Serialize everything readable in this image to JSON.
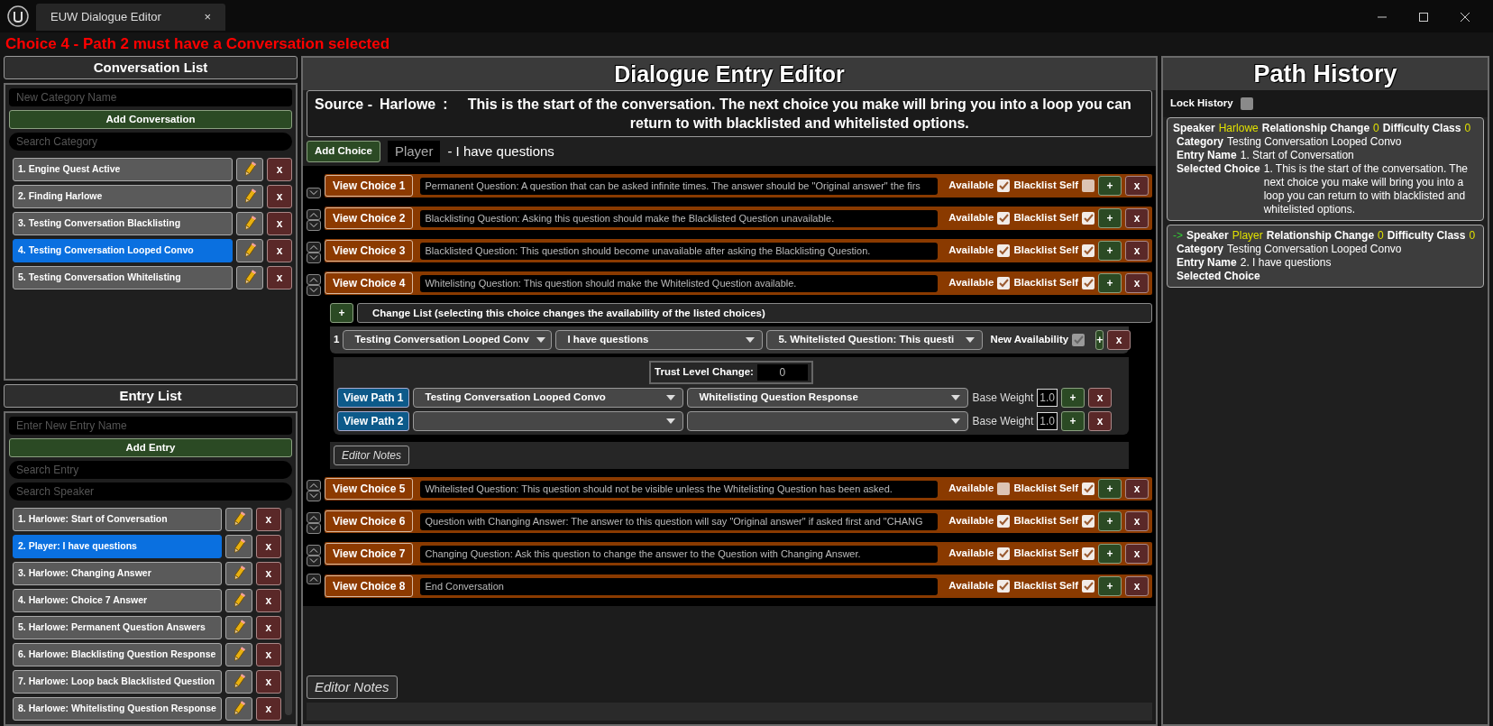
{
  "window": {
    "title": "EUW Dialogue Editor",
    "close": "×"
  },
  "error": "Choice 4 - Path 2 must have a Conversation selected",
  "conversation_list": {
    "title": "Conversation List",
    "new_placeholder": "New Category Name",
    "add_button": "Add Conversation",
    "search_placeholder": "Search Category",
    "items": [
      {
        "label": "1. Engine Quest Active",
        "selected": false,
        "remove": "x"
      },
      {
        "label": "2. Finding Harlowe",
        "selected": false,
        "remove": "x"
      },
      {
        "label": "3. Testing Conversation Blacklisting",
        "selected": false,
        "remove": "x"
      },
      {
        "label": "4. Testing Conversation Looped Convo",
        "selected": true,
        "remove": "x"
      },
      {
        "label": "5. Testing Conversation Whitelisting",
        "selected": false,
        "remove": "x"
      }
    ]
  },
  "entry_list": {
    "title": "Entry List",
    "new_placeholder": "Enter New Entry Name",
    "add_button": "Add Entry",
    "search_entry_placeholder": "Search Entry",
    "search_speaker_placeholder": "Search Speaker",
    "items": [
      {
        "label": "1. Harlowe: Start of Conversation",
        "selected": false,
        "remove": "x"
      },
      {
        "label": "2. Player: I have questions",
        "selected": true,
        "remove": "x"
      },
      {
        "label": "3. Harlowe: Changing Answer",
        "selected": false,
        "remove": "x"
      },
      {
        "label": "4. Harlowe: Choice 7 Answer",
        "selected": false,
        "remove": "x"
      },
      {
        "label": "5. Harlowe: Permanent Question Answers",
        "selected": false,
        "remove": "x"
      },
      {
        "label": "6. Harlowe: Blacklisting Question Response",
        "selected": false,
        "remove": "x"
      },
      {
        "label": "7. Harlowe: Loop back Blacklisted Question",
        "selected": false,
        "remove": "x"
      },
      {
        "label": "8. Harlowe: Whitelisting Question Response",
        "selected": false,
        "remove": "x"
      }
    ]
  },
  "editor": {
    "title": "Dialogue Entry Editor",
    "source_label": "Source -",
    "source_speaker": "Harlowe",
    "source_colon": ":",
    "source_text": "This is the start of the conversation. The next choice you make will bring you into a loop you can return to with blacklisted and whitelisted options.",
    "add_choice": "Add Choice",
    "speaker": "Player",
    "entry_text": "- I have questions",
    "choices": [
      {
        "move_up": false,
        "move_down": true,
        "button": "View Choice 1",
        "text": "Permanent Question: A question that can be asked infinite times. The answer should be \"Original answer\" the firs",
        "available_label": "Available",
        "available": true,
        "blacklist_label": "Blacklist Self",
        "blacklist_self": false,
        "add": "+",
        "remove": "x"
      },
      {
        "move_up": true,
        "move_down": true,
        "button": "View Choice 2",
        "text": "Blacklisting Question: Asking this question should make the Blacklisted Question unavailable.",
        "available_label": "Available",
        "available": true,
        "blacklist_label": "Blacklist Self",
        "blacklist_self": true,
        "add": "+",
        "remove": "x"
      },
      {
        "move_up": true,
        "move_down": true,
        "button": "View Choice 3",
        "text": "Blacklisted Question: This question should become unavailable after asking the Blacklisting Question.",
        "available_label": "Available",
        "available": true,
        "blacklist_label": "Blacklist Self",
        "blacklist_self": true,
        "add": "+",
        "remove": "x"
      },
      {
        "move_up": true,
        "move_down": true,
        "button": "View Choice 4",
        "text": "Whitelisting Question: This question should make the Whitelisted Question available.",
        "available_label": "Available",
        "available": true,
        "blacklist_label": "Blacklist Self",
        "blacklist_self": true,
        "add": "+",
        "remove": "x",
        "details": {
          "change_add": "+",
          "change_title": "Change List (selecting this choice changes the availability of the listed choices)",
          "change_rows": [
            {
              "index": "1",
              "conversation": "Testing Conversation Looped Conv",
              "entry": "I have questions",
              "choice": "5. Whitelisted Question: This questi",
              "availability_label": "New Availability",
              "new_availability": true,
              "add": "+",
              "remove": "x"
            }
          ],
          "trust_label": "Trust Level Change:",
          "trust_value": "0",
          "paths": [
            {
              "button": "View Path 1",
              "conversation": "Testing Conversation Looped Convo",
              "entry": "Whitelisting Question Response",
              "weight_label": "Base Weight",
              "weight": "1.0",
              "add": "+",
              "remove": "x"
            },
            {
              "button": "View Path 2",
              "weight_label": "Base Weight",
              "weight": "1.0",
              "add": "+",
              "remove": "x"
            }
          ],
          "editor_notes": "Editor Notes"
        }
      },
      {
        "move_up": true,
        "move_down": true,
        "button": "View Choice 5",
        "text": "Whitelisted Question: This question should not be visible unless the Whitelisting Question has been asked.",
        "available_label": "Available",
        "available": false,
        "blacklist_label": "Blacklist Self",
        "blacklist_self": true,
        "add": "+",
        "remove": "x"
      },
      {
        "move_up": true,
        "move_down": true,
        "button": "View Choice 6",
        "text": "Question with Changing Answer: The answer to this question will say \"Original answer\" if asked first and \"CHANG",
        "available_label": "Available",
        "available": true,
        "blacklist_label": "Blacklist Self",
        "blacklist_self": true,
        "add": "+",
        "remove": "x"
      },
      {
        "move_up": true,
        "move_down": true,
        "button": "View Choice 7",
        "text": "Changing Question: Ask this question to change the answer to the Question with Changing Answer.",
        "available_label": "Available",
        "available": true,
        "blacklist_label": "Blacklist Self",
        "blacklist_self": true,
        "add": "+",
        "remove": "x"
      },
      {
        "move_up": true,
        "move_down": false,
        "button": "View Choice 8",
        "text": "End Conversation",
        "available_label": "Available",
        "available": true,
        "blacklist_label": "Blacklist Self",
        "blacklist_self": true,
        "add": "+",
        "remove": "x"
      }
    ],
    "editor_notes": "Editor Notes"
  },
  "path_history": {
    "title": "Path History",
    "lock_label": "Lock History",
    "lock_history": false,
    "cards": [
      {
        "speaker_label": "Speaker",
        "speaker": "Harlowe",
        "relationship_label": "Relationship Change",
        "relationship": "0",
        "difficulty_label": "Difficulty Class",
        "difficulty": "0",
        "category_label": "Category",
        "category": "Testing Conversation Looped Convo",
        "entry_label": "Entry Name",
        "entry": "1. Start of Conversation",
        "choice_label": "Selected Choice",
        "choice": "1. This is the start of the conversation. The next choice you make will bring you into a loop you can return to with blacklisted and whitelisted options."
      },
      {
        "marker": "->",
        "speaker_label": "Speaker",
        "speaker": "Player",
        "relationship_label": "Relationship Change",
        "relationship": "0",
        "difficulty_label": "Difficulty Class",
        "difficulty": "0",
        "category_label": "Category",
        "category": "Testing Conversation Looped Convo",
        "entry_label": "Entry Name",
        "entry": "2. I have questions",
        "choice_label": "Selected Choice"
      }
    ]
  }
}
